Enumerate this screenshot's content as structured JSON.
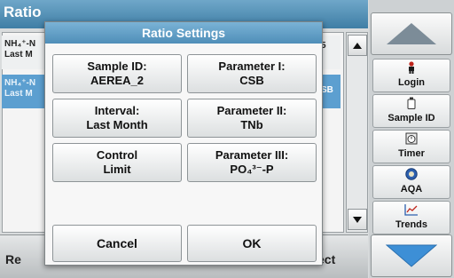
{
  "background": {
    "title": "Ratio",
    "row1_line1": "NH₄⁺-N",
    "row1_line2": "Last M",
    "row1_extra": "5",
    "row2_line1": "NH₄⁺-N",
    "row2_line2": "Last M",
    "row2_extra": "SB",
    "bottom_left": "Re",
    "bottom_right": "ect"
  },
  "sidebar": {
    "login": "Login",
    "sample_id": "Sample ID",
    "timer": "Timer",
    "aqa": "AQA",
    "trends": "Trends"
  },
  "dialog": {
    "title": "Ratio Settings",
    "sample_id_label": "Sample ID:",
    "sample_id_value": "AEREA_2",
    "param1_label": "Parameter I:",
    "param1_value": "CSB",
    "interval_label": "Interval:",
    "interval_value": "Last Month",
    "param2_label": "Parameter II:",
    "param2_value": "TNb",
    "control_line1": "Control",
    "control_line2": "Limit",
    "param3_label": "Parameter III:",
    "param3_value": "PO₄³⁻-P",
    "cancel": "Cancel",
    "ok": "OK"
  },
  "icons": {
    "scroll_up": "scroll-up-arrow",
    "scroll_down": "scroll-down-arrow",
    "login": "person-icon",
    "sample": "sample-bottle-icon",
    "timer": "stopwatch-icon",
    "aqa": "aqa-icon",
    "trends": "trend-chart-icon"
  },
  "colors": {
    "title_bar": "#4f8eb8",
    "selected_row": "#5c9fd0"
  }
}
